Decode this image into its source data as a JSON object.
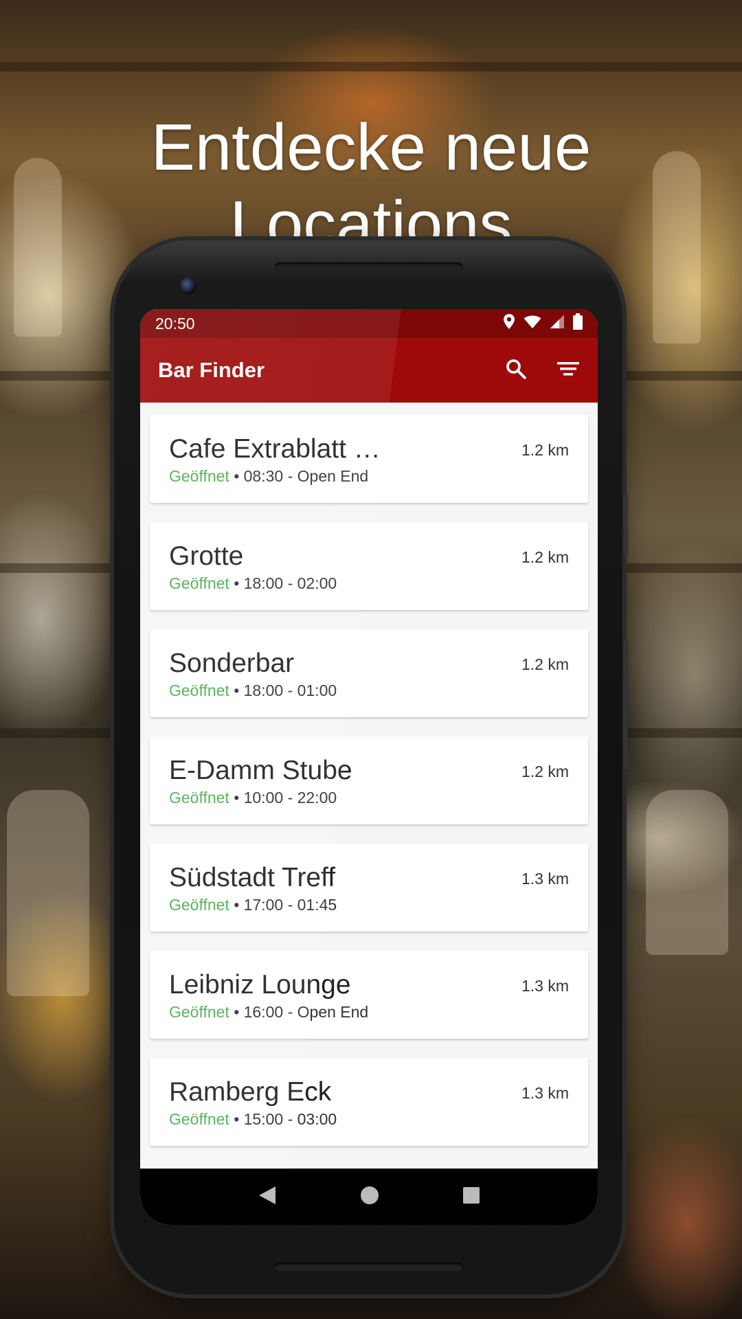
{
  "headline": {
    "line1": "Entdecke neue",
    "line2": "Locations"
  },
  "status_bar": {
    "time": "20:50"
  },
  "app_bar": {
    "title": "Bar Finder"
  },
  "colors": {
    "primary": "#9e0a0a",
    "primary_dark": "#7d0606",
    "open_status": "#4caf50"
  },
  "icons": {
    "search": "search-icon",
    "sort": "sort-icon",
    "location": "location-icon",
    "wifi": "wifi-icon",
    "signal": "signal-icon",
    "battery": "battery-icon"
  },
  "bars": [
    {
      "name": "Cafe Extrablatt …",
      "status": "Geöffnet",
      "hours": "• 08:30 - Open End",
      "distance": "1.2 km"
    },
    {
      "name": "Grotte",
      "status": "Geöffnet",
      "hours": "• 18:00 - 02:00",
      "distance": "1.2 km"
    },
    {
      "name": "Sonderbar",
      "status": "Geöffnet",
      "hours": "• 18:00 - 01:00",
      "distance": "1.2 km"
    },
    {
      "name": "E-Damm Stube",
      "status": "Geöffnet",
      "hours": "• 10:00 - 22:00",
      "distance": "1.2 km"
    },
    {
      "name": "Südstadt Treff",
      "status": "Geöffnet",
      "hours": "• 17:00 - 01:45",
      "distance": "1.3 km"
    },
    {
      "name": "Leibniz Lounge",
      "status": "Geöffnet",
      "hours": "• 16:00 - Open End",
      "distance": "1.3 km"
    },
    {
      "name": "Ramberg Eck",
      "status": "Geöffnet",
      "hours": "• 15:00 - 03:00",
      "distance": "1.3 km"
    }
  ]
}
